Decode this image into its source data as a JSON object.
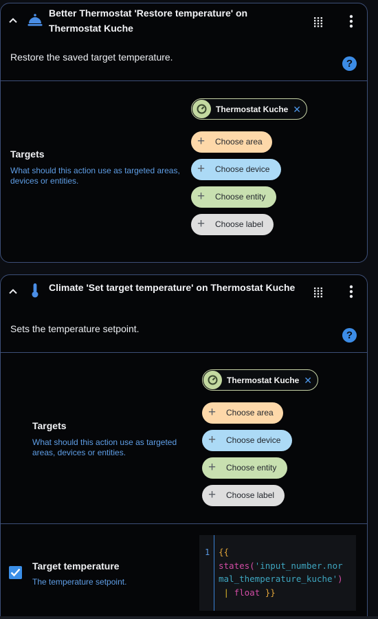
{
  "cards": [
    {
      "title": "Better Thermostat 'Restore temperature' on Thermostat Kuche",
      "description": "Restore the saved target temperature.",
      "targets": {
        "label": "Targets",
        "description": "What should this action use as targeted areas, devices or entities.",
        "selected": "Thermostat Kuche",
        "choose_area": "Choose area",
        "choose_device": "Choose device",
        "choose_entity": "Choose entity",
        "choose_label": "Choose label"
      }
    },
    {
      "title": "Climate 'Set target temperature' on Thermostat Kuche",
      "description": "Sets the temperature setpoint.",
      "targets": {
        "label": "Targets",
        "description": "What should this action use as targeted areas, devices or entities.",
        "selected": "Thermostat Kuche",
        "choose_area": "Choose area",
        "choose_device": "Choose device",
        "choose_entity": "Choose entity",
        "choose_label": "Choose label"
      },
      "target_temperature": {
        "label": "Target temperature",
        "description": "The temperature setpoint.",
        "enabled": true,
        "line_number": "1",
        "code_line1": "{{",
        "code_fn": "states(",
        "code_str1": "'input_number.nor",
        "code_str2": "mal_themperature_kuche'",
        "code_close": ")",
        "code_pipe": "|",
        "code_filter": "float",
        "code_end": "}}"
      }
    }
  ],
  "icons": {
    "collapse": "chevron-up-icon",
    "bt_domain": "bell-service-icon",
    "climate_domain": "thermometer-icon",
    "drag": "drag-handle-icon",
    "menu": "dots-vertical-icon",
    "help": "help-circle-icon",
    "entity": "thermostat-icon",
    "remove": "close-icon",
    "add": "plus-icon"
  },
  "colors": {
    "accent": "#3b8fe8",
    "card_border": "#3d4f78",
    "area_chip": "#fdd8a9",
    "device_chip": "#acdaf6",
    "entity_chip": "#c8e0b0",
    "label_chip": "#dedede"
  }
}
